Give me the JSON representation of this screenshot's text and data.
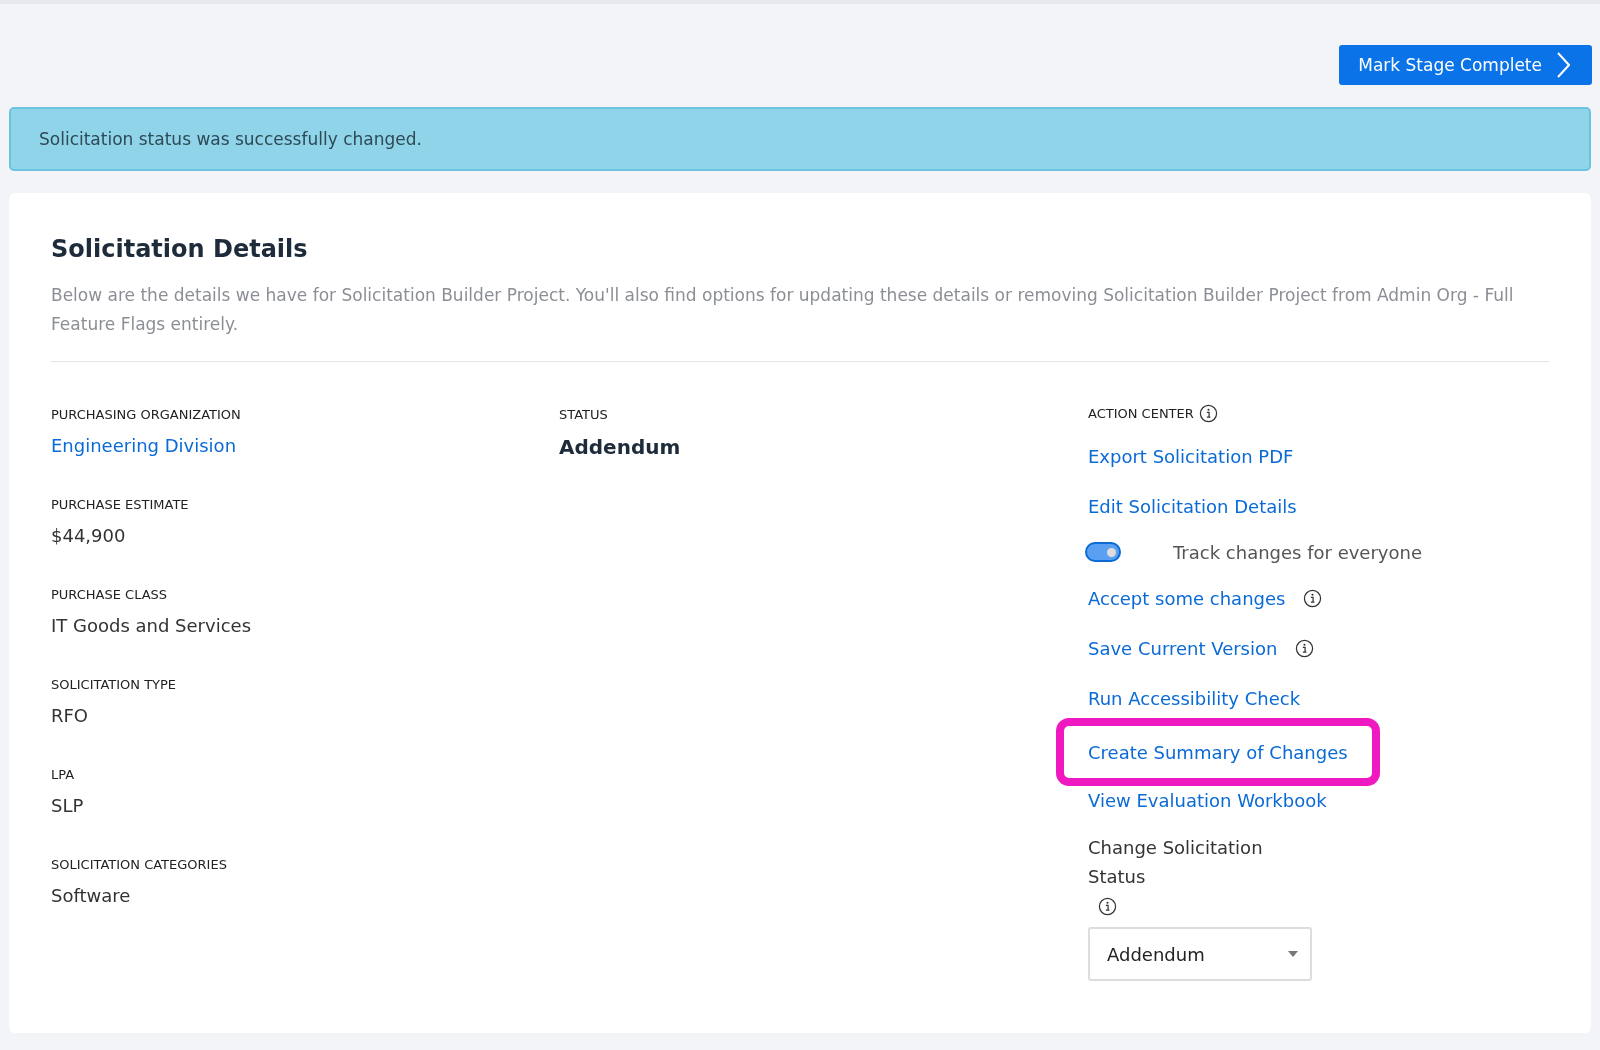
{
  "header": {
    "button": "Mark Stage Complete"
  },
  "alert": {
    "message": "Solicitation status was successfully changed."
  },
  "card": {
    "title": "Solicitation Details",
    "description": "Below are the details we have for Solicitation Builder Project. You'll also find options for updating these details or removing Solicitation Builder Project from Admin Org - Full Feature Flags entirely.",
    "fields": [
      {
        "label": "PURCHASING ORGANIZATION",
        "value": "Engineering Division",
        "kind": "link"
      },
      {
        "label": "PURCHASE ESTIMATE",
        "value": "$44,900",
        "kind": "text"
      },
      {
        "label": "PURCHASE CLASS",
        "value": "IT Goods and Services",
        "kind": "text"
      },
      {
        "label": "SOLICITATION TYPE",
        "value": "RFO",
        "kind": "text"
      },
      {
        "label": "LPA",
        "value": "SLP",
        "kind": "text"
      },
      {
        "label": "SOLICITATION CATEGORIES",
        "value": "Software",
        "kind": "text"
      }
    ],
    "status": {
      "label": "STATUS",
      "value": "Addendum"
    },
    "action_center": {
      "label": "ACTION CENTER",
      "items": [
        {
          "kind": "link",
          "label": "Export Solicitation PDF",
          "info": false,
          "highlighted": false
        },
        {
          "kind": "link",
          "label": "Edit Solicitation Details",
          "info": false,
          "highlighted": false
        },
        {
          "kind": "toggle",
          "label": "Track changes for everyone",
          "on": true
        },
        {
          "kind": "link",
          "label": "Accept some changes",
          "info": true,
          "highlighted": false
        },
        {
          "kind": "link",
          "label": "Save Current Version",
          "info": true,
          "highlighted": false
        },
        {
          "kind": "link",
          "label": "Run Accessibility Check",
          "info": false,
          "highlighted": false
        },
        {
          "kind": "link",
          "label": "Create Summary of Changes",
          "info": false,
          "highlighted": true
        },
        {
          "kind": "link",
          "label": "View Evaluation Workbook",
          "info": false,
          "highlighted": false
        }
      ],
      "status_select": {
        "label": "Change Solicitation Status",
        "value": "Addendum"
      }
    }
  }
}
